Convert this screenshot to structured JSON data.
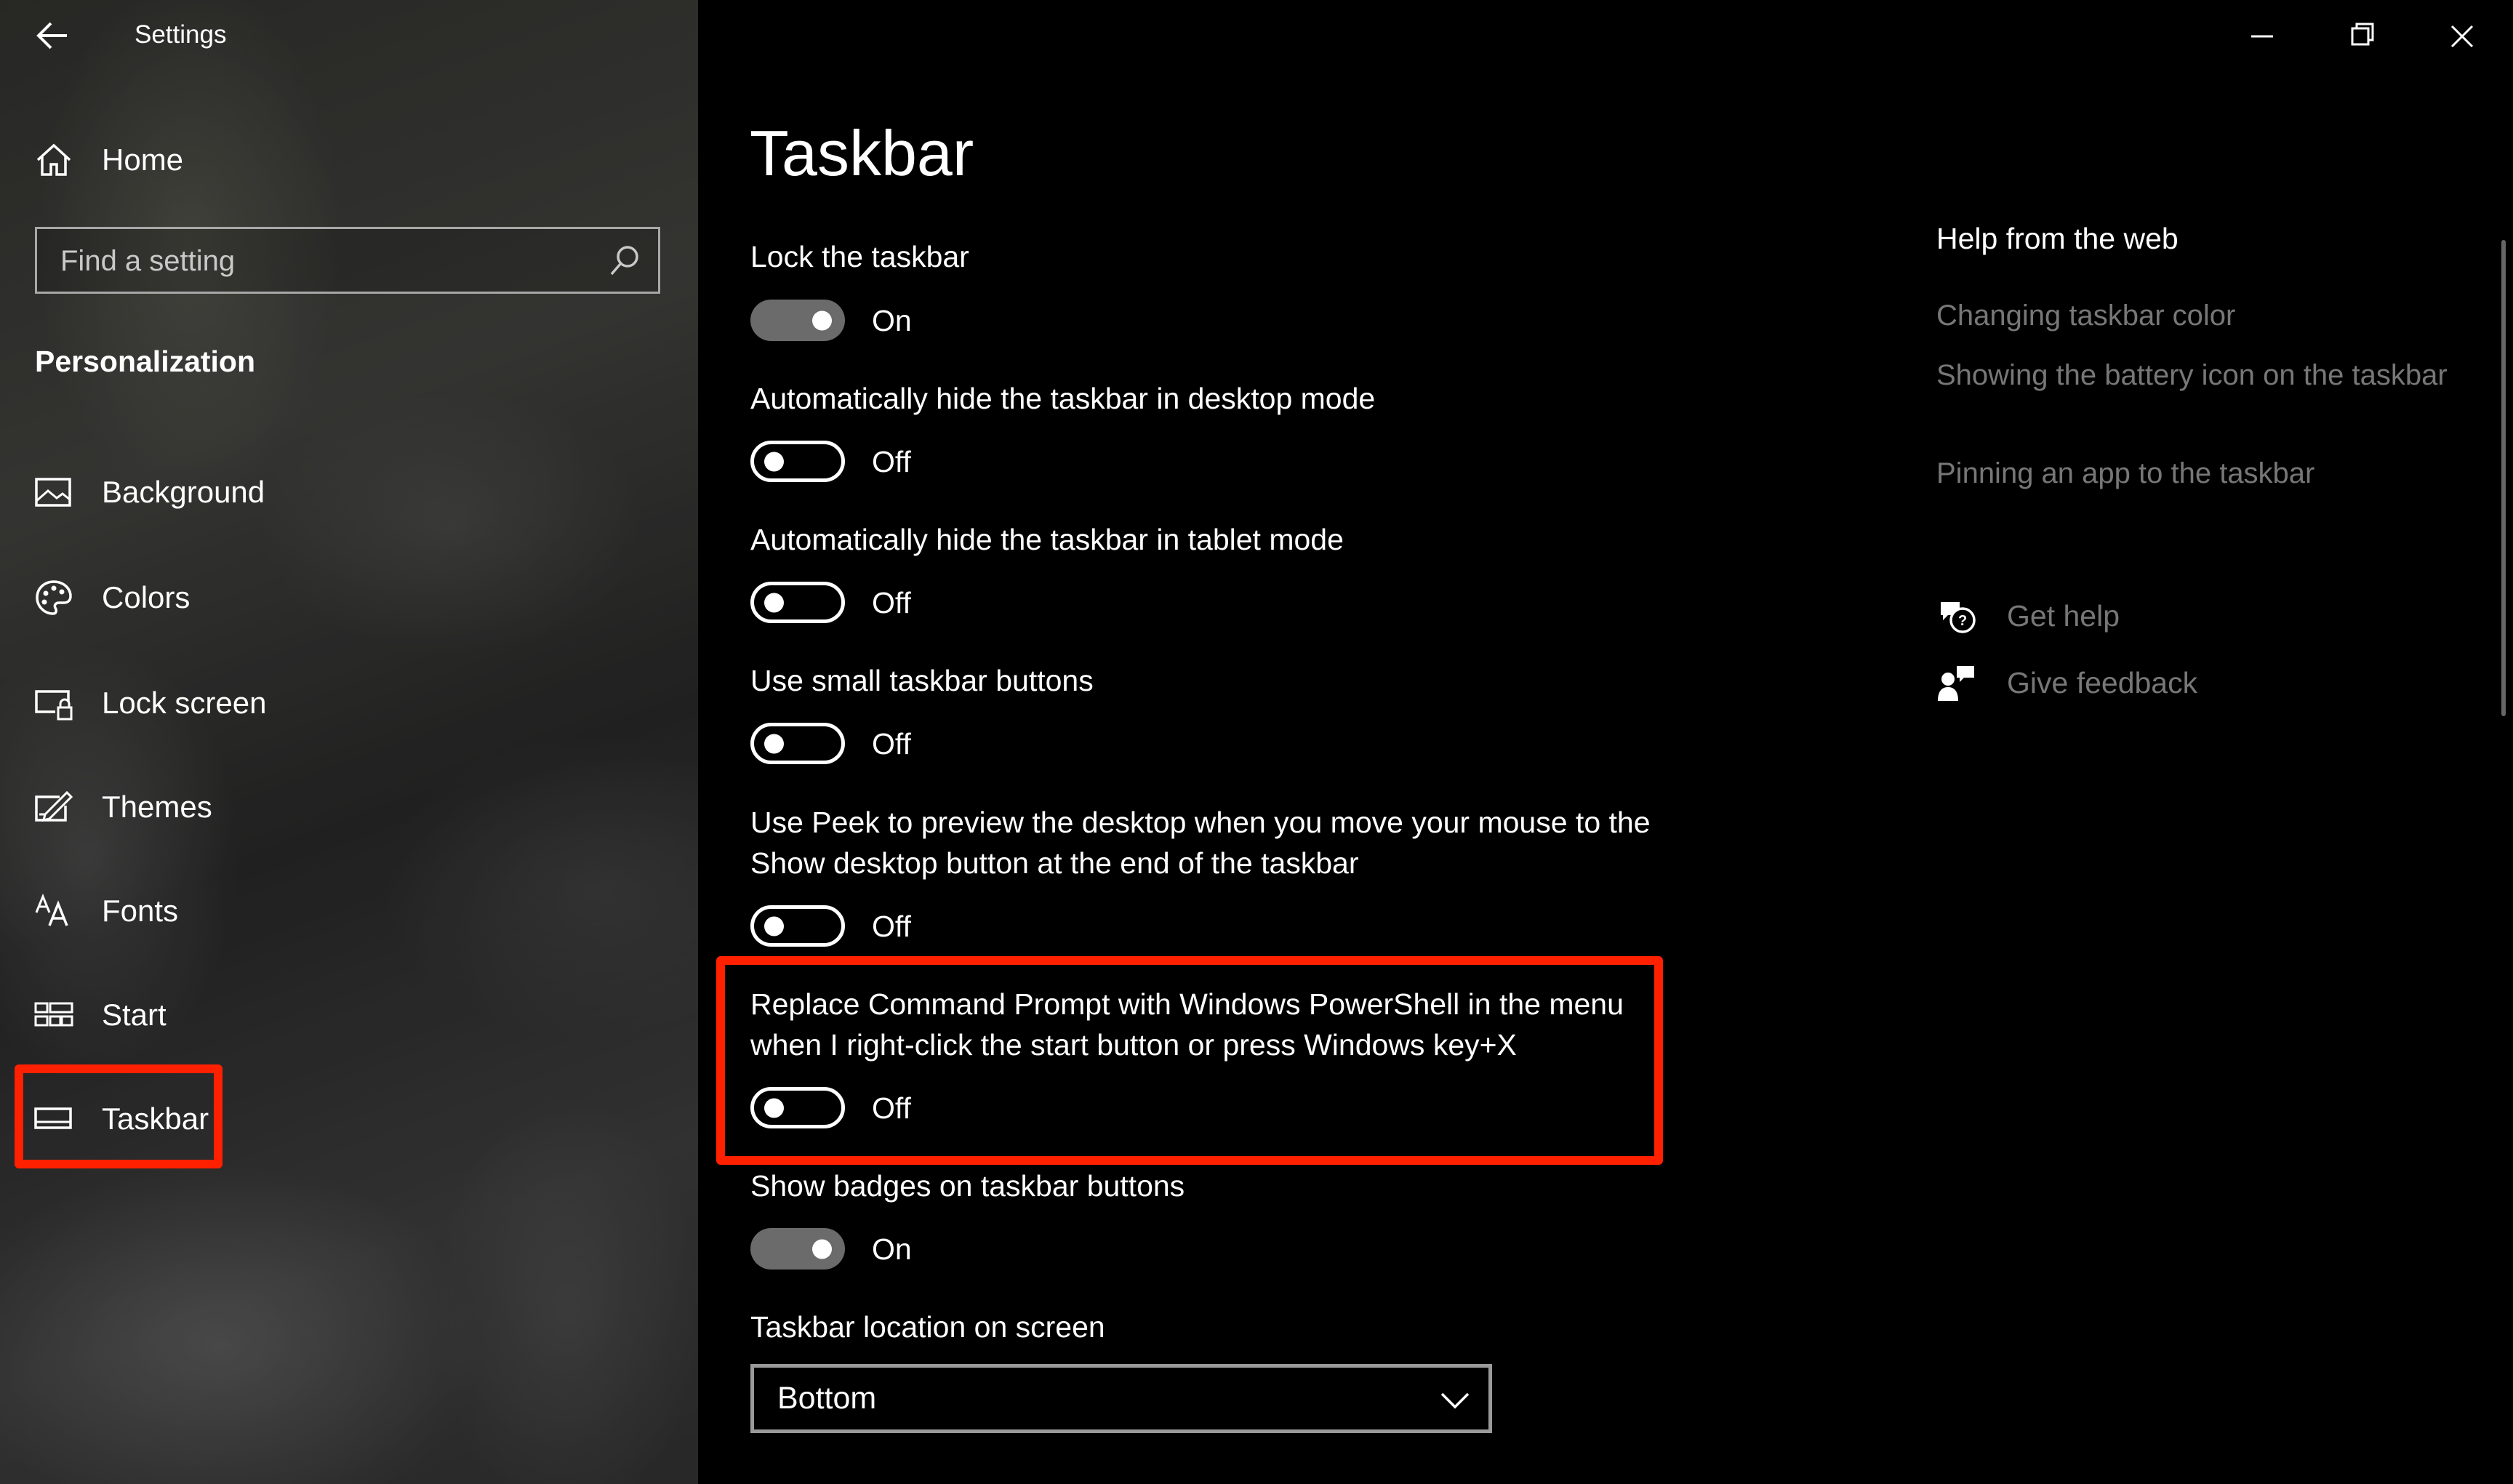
{
  "window": {
    "title": "Settings"
  },
  "sidebar": {
    "home_label": "Home",
    "search_placeholder": "Find a setting",
    "section_label": "Personalization",
    "items": [
      {
        "label": "Background",
        "icon": "image-icon"
      },
      {
        "label": "Colors",
        "icon": "palette-icon"
      },
      {
        "label": "Lock screen",
        "icon": "lock-screen-icon"
      },
      {
        "label": "Themes",
        "icon": "themes-icon"
      },
      {
        "label": "Fonts",
        "icon": "fonts-icon"
      },
      {
        "label": "Start",
        "icon": "start-icon"
      },
      {
        "label": "Taskbar",
        "icon": "taskbar-icon",
        "selected": true
      }
    ]
  },
  "main": {
    "title": "Taskbar",
    "settings": [
      {
        "label": "Lock the taskbar",
        "state": "On"
      },
      {
        "label": "Automatically hide the taskbar in desktop mode",
        "state": "Off"
      },
      {
        "label": "Automatically hide the taskbar in tablet mode",
        "state": "Off"
      },
      {
        "label": "Use small taskbar buttons",
        "state": "Off"
      },
      {
        "label_line1": "Use Peek to preview the desktop when you move your mouse to the",
        "label_line2": "Show desktop button at the end of the taskbar",
        "state": "Off"
      },
      {
        "label_line1": "Replace Command Prompt with Windows PowerShell in the menu",
        "label_line2": "when I right-click the start button or press Windows key+X",
        "state": "Off"
      },
      {
        "label": "Show badges on taskbar buttons",
        "state": "On"
      }
    ],
    "location": {
      "label": "Taskbar location on screen",
      "value": "Bottom"
    }
  },
  "help": {
    "title": "Help from the web",
    "links": [
      "Changing taskbar color",
      "Showing the battery icon on the taskbar",
      "Pinning an app to the taskbar"
    ],
    "get_help": "Get help",
    "give_feedback": "Give feedback"
  },
  "colors": {
    "highlight": "#ff2000",
    "toggle_on_track": "#6b6b6b",
    "muted_link": "#777777"
  }
}
